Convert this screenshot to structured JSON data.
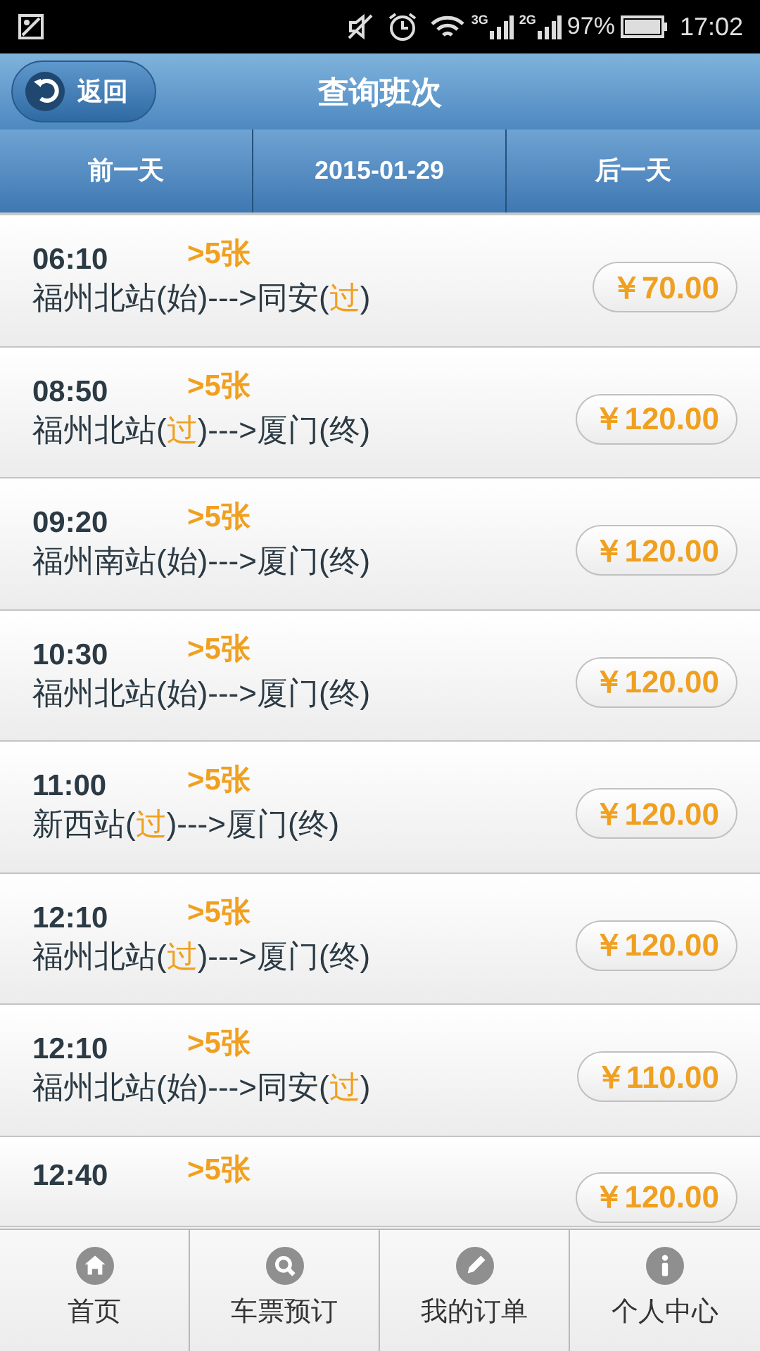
{
  "status_bar": {
    "network_1": "3G",
    "network_2": "2G",
    "battery": "97%",
    "time": "17:02"
  },
  "header": {
    "back": "返回",
    "title": "查询班次"
  },
  "date_bar": {
    "prev": "前一天",
    "date": "2015-01-29",
    "next": "后一天"
  },
  "trips": [
    {
      "time": "06:10",
      "tickets": ">5张",
      "route": [
        {
          "text": "福州北站(始)--->同安(",
          "highlight": false
        },
        {
          "text": "过",
          "highlight": true
        },
        {
          "text": ")",
          "highlight": false
        }
      ],
      "price": "￥70.00"
    },
    {
      "time": "08:50",
      "tickets": ">5张",
      "route": [
        {
          "text": "福州北站(",
          "highlight": false
        },
        {
          "text": "过",
          "highlight": true
        },
        {
          "text": ")--->厦门(终)",
          "highlight": false
        }
      ],
      "price": "￥120.00"
    },
    {
      "time": "09:20",
      "tickets": ">5张",
      "route": [
        {
          "text": "福州南站(始)--->厦门(终)",
          "highlight": false
        }
      ],
      "price": "￥120.00"
    },
    {
      "time": "10:30",
      "tickets": ">5张",
      "route": [
        {
          "text": "福州北站(始)--->厦门(终)",
          "highlight": false
        }
      ],
      "price": "￥120.00"
    },
    {
      "time": "11:00",
      "tickets": ">5张",
      "route": [
        {
          "text": "新西站(",
          "highlight": false
        },
        {
          "text": "过",
          "highlight": true
        },
        {
          "text": ")--->厦门(终)",
          "highlight": false
        }
      ],
      "price": "￥120.00"
    },
    {
      "time": "12:10",
      "tickets": ">5张",
      "route": [
        {
          "text": "福州北站(",
          "highlight": false
        },
        {
          "text": "过",
          "highlight": true
        },
        {
          "text": ")--->厦门(终)",
          "highlight": false
        }
      ],
      "price": "￥120.00"
    },
    {
      "time": "12:10",
      "tickets": ">5张",
      "route": [
        {
          "text": "福州北站(始)--->同安(",
          "highlight": false
        },
        {
          "text": "过",
          "highlight": true
        },
        {
          "text": ")",
          "highlight": false
        }
      ],
      "price": "￥110.00"
    },
    {
      "time": "12:40",
      "tickets": ">5张",
      "price": "￥120.00"
    }
  ],
  "bottom_nav": [
    {
      "label": "首页"
    },
    {
      "label": "车票预订"
    },
    {
      "label": "我的订单"
    },
    {
      "label": "个人中心"
    }
  ]
}
